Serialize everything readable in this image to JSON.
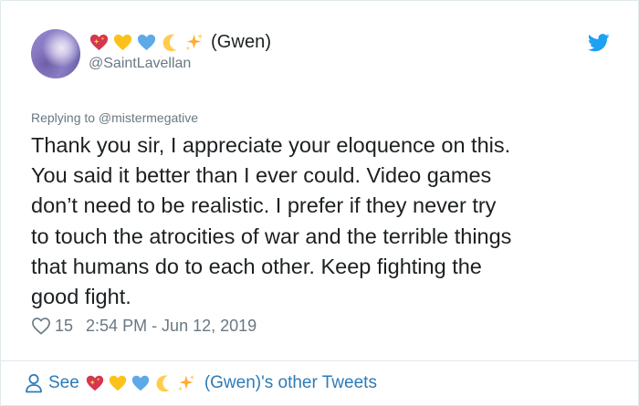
{
  "tweet": {
    "display_name": "(Gwen)",
    "name_emojis": [
      "heart-sparkle-icon",
      "yellow-heart-icon",
      "blue-heart-icon",
      "crescent-moon-icon",
      "sparkles-icon"
    ],
    "handle": "@SaintLavellan",
    "replying_to": "Replying to @mistermegative",
    "text": "Thank you sir, I appreciate your eloquence on this.\nYou said it better than I ever could. Video games\ndon’t need to be realistic. I prefer if they never try\nto touch the atrocities of war and the terrible things\nthat humans do to each other. Keep fighting the\ngood fight.",
    "likes": "15",
    "timestamp": "2:54 PM - Jun 12, 2019"
  },
  "footer": {
    "see_label": "See",
    "other_tweets_label": "(Gwen)'s other Tweets"
  },
  "colors": {
    "link": "#2b7bb9",
    "muted": "#697882",
    "text": "#1c2022",
    "twitter_blue": "#1da1f2",
    "border": "#e1e8ed"
  }
}
